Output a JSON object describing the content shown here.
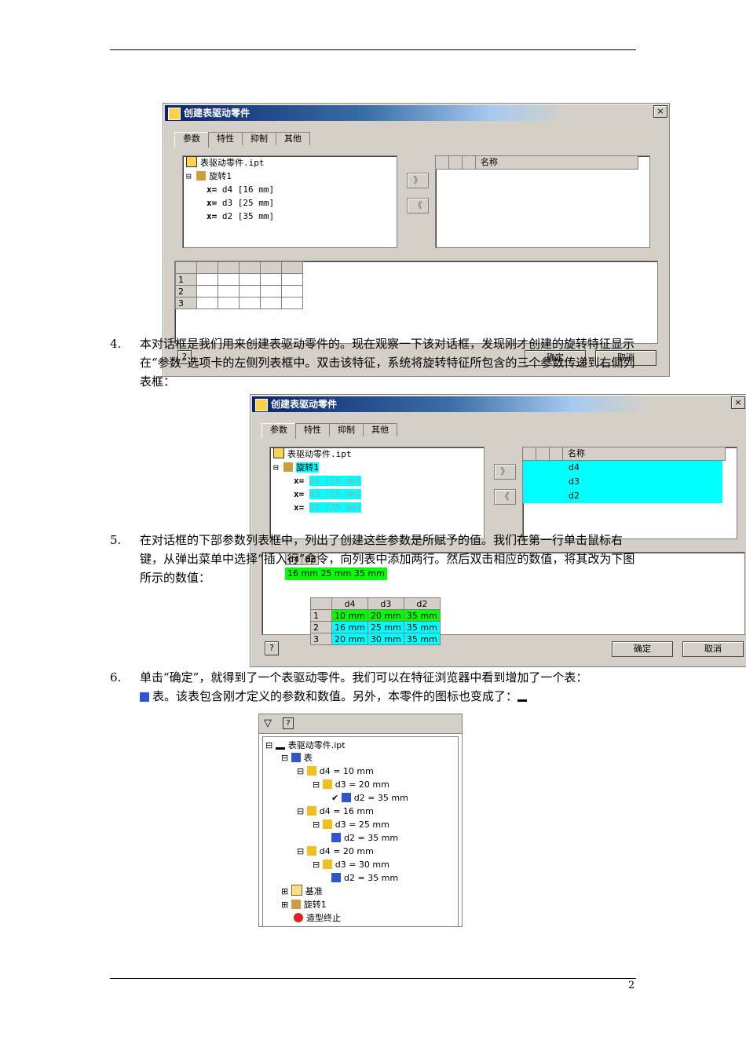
{
  "page": {
    "number": "2"
  },
  "dialog1": {
    "title": "创建表驱动零件",
    "close": "×",
    "tabs": [
      "参数",
      "特性",
      "抑制",
      "其他"
    ],
    "tree": {
      "root": "表驱动零件.ipt",
      "feature": "旋转1",
      "params": [
        "d4 [16 mm]",
        "d3 [25 mm]",
        "d2 [35 mm]"
      ]
    },
    "right_header": "名称",
    "add_btn": "》",
    "remove_btn": "《",
    "rows": [
      "1",
      "2",
      "3"
    ],
    "help": "?",
    "ok": "确定",
    "cancel": "取消"
  },
  "para4": {
    "num": "4.",
    "text": "本对话框是我们用来创建表驱动零件的。现在观察一下该对话框，发现刚才创建的旋转特征显示在“参数”选项卡的左侧列表框中。双击该特征，系统将旋转特征所包含的三个参数传递到右侧列表框："
  },
  "dialog2": {
    "title": "创建表驱动零件",
    "close": "×",
    "tabs": [
      "参数",
      "特性",
      "抑制",
      "其他"
    ],
    "tree": {
      "root": "表驱动零件.ipt",
      "feature": "旋转1",
      "params": [
        "d4 [16 mm]",
        "d3 [25 mm]",
        "d2 [35 mm]"
      ]
    },
    "right_header": "名称",
    "right_items": [
      "d4",
      "d3",
      "d2"
    ],
    "add_btn": "》",
    "remove_btn": "《",
    "mini_grid": {
      "headers": [
        "d4",
        "d2"
      ],
      "values": [
        "16 mm",
        "25 mm",
        "35 mm"
      ]
    },
    "grid": {
      "headers": [
        "d4",
        "d3",
        "d2"
      ],
      "rows": [
        {
          "n": "1",
          "d4": "10 mm",
          "d3": "20 mm",
          "d2": "35 mm"
        },
        {
          "n": "2",
          "d4": "16 mm",
          "d3": "25 mm",
          "d2": "35 mm"
        },
        {
          "n": "3",
          "d4": "20 mm",
          "d3": "30 mm",
          "d2": "35 mm"
        }
      ]
    },
    "help": "?",
    "ok": "确定",
    "cancel": "取消"
  },
  "para5": {
    "num": "5.",
    "text": "在对话框的下部参数列表框中，列出了创建这些参数是所赋予的值。我们在第一行单击鼠标右键，从弹出菜单中选择“插入行”命令，向列表中添加两行。然后双击相应的数值，将其改为下图所示的数值："
  },
  "para6": {
    "num": "6.",
    "text1": "单击“确定”，就得到了一个表驱动零件。我们可以在特征浏览器中看到增加了一个表：",
    "text2": "表。该表包含刚才定义的参数和数值。另外，本零件的图标也变成了："
  },
  "browser": {
    "rows": [
      {
        "label": "表驱动零件.ipt",
        "icon": "part-table-icon"
      },
      {
        "label": "表",
        "icon": "table-icon"
      },
      {
        "label": "d4 = 10 mm",
        "icon": "param-icon"
      },
      {
        "label": "d3 = 20 mm",
        "icon": "param-icon"
      },
      {
        "label": "d2 = 35 mm",
        "icon": "param-check-icon"
      },
      {
        "label": "d4 = 16 mm",
        "icon": "param-icon"
      },
      {
        "label": "d3 = 25 mm",
        "icon": "param-icon"
      },
      {
        "label": "d2 = 35 mm",
        "icon": "param-icon"
      },
      {
        "label": "d4 = 20 mm",
        "icon": "param-icon"
      },
      {
        "label": "d3 = 30 mm",
        "icon": "param-icon"
      },
      {
        "label": "d2 = 35 mm",
        "icon": "param-icon"
      },
      {
        "label": "基准",
        "icon": "folder-icon"
      },
      {
        "label": "旋转1",
        "icon": "revolve-icon"
      },
      {
        "label": "造型终止",
        "icon": "end-of-part-icon"
      }
    ]
  }
}
